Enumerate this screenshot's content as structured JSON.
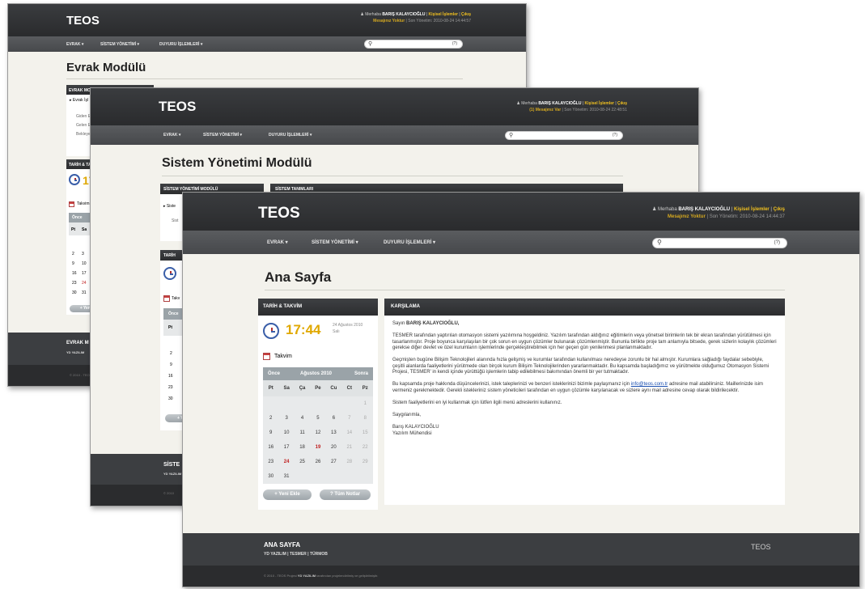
{
  "app": {
    "logo": "TEOS"
  },
  "user": {
    "greeting": "Merhaba",
    "name": "BARIŞ KALAYCIOĞLU",
    "sep": "|",
    "personal_link": "Kişisel İşlemler",
    "logout_link": "Çıkış",
    "messages_none": "Mesajınız Yoktur",
    "messages_back": "(1) Mesajınız Var",
    "last_login_label": "Son Yönetim:",
    "last_login_back": "2010-08-24 14:44:57",
    "last_login_mid": "2010-08-24 22:48:51",
    "last_login_front": "2010-08-24 14:44:37"
  },
  "nav": {
    "items": [
      "EVRAK ▾",
      "SİSTEM YÖNETİMİ ▾",
      "DUYURU İŞLEMLERİ ▾"
    ],
    "search_help": "(?)",
    "search_icon": "magnifier-icon"
  },
  "back": {
    "title": "Evrak Modülü",
    "panel1": "EVRAK MODÜLÜ",
    "list_item": "▸ Evrak İşl",
    "sub_items": [
      "Giden E",
      "Gelen E",
      "Bekleye"
    ],
    "date_panel": "TARİH & TA",
    "time_partial": "17",
    "cal_label": "Takvim",
    "cal_prev": "Önce",
    "weekdays_partial": [
      "Pt",
      "Sa"
    ],
    "days_partial": [
      [
        "2",
        "3"
      ],
      [
        "9",
        "10"
      ],
      [
        "16",
        "17"
      ],
      [
        "23",
        "24"
      ],
      [
        "30",
        "31"
      ]
    ],
    "btn_partial": "+ Yeni",
    "footer_title": "EVRAK M",
    "footer_sub": "YD YAZILIM",
    "copyright": "© 2010 - TEOS"
  },
  "mid": {
    "title": "Sistem Yönetimi Modülü",
    "panel1": "SİSTEM YÖNETİMİ MODÜLÜ",
    "panel2": "SİSTEM TANIMLARI",
    "list_item": "▸ Siste",
    "sub_item": "Sist",
    "date_panel": "TARİH",
    "cal_label": "Takv",
    "cal_prev": "Önce",
    "weekday": "Pt",
    "days_partial": [
      "2",
      "9",
      "16",
      "23",
      "30"
    ],
    "btn_partial": "+ Ye",
    "footer_title": "SİSTE",
    "footer_sub": "YD YAZILIM",
    "copyright": "© 2010"
  },
  "front": {
    "title": "Ana Sayfa",
    "date_panel": "TARİH & TAKVİM",
    "time": "17:44",
    "date_line1": "24 Ağustos 2010",
    "date_line2": "Salı",
    "cal_label": "Takvim",
    "cal_prev": "Önce",
    "cal_month": "Ağustos 2010",
    "cal_next": "Sonra",
    "weekdays": [
      "Pt",
      "Sa",
      "Ça",
      "Pe",
      "Cu",
      "Ct",
      "Pz"
    ],
    "weeks": [
      [
        "",
        "",
        "",
        "",
        "",
        "",
        "1"
      ],
      [
        "2",
        "3",
        "4",
        "5",
        "6",
        "7",
        "8"
      ],
      [
        "9",
        "10",
        "11",
        "12",
        "13",
        "14",
        "15"
      ],
      [
        "16",
        "17",
        "18",
        "19",
        "20",
        "21",
        "22"
      ],
      [
        "23",
        "24",
        "25",
        "26",
        "27",
        "28",
        "29"
      ],
      [
        "30",
        "31",
        "",
        "",
        "",
        "",
        ""
      ]
    ],
    "today": "19",
    "highlight": "24",
    "btn_new": "+ Yeni Ekle",
    "btn_all": "? Tüm Notlar",
    "welcome_panel": "KARŞILAMA",
    "salutation": "Sayın",
    "salutation_name": "BARIŞ KALAYCIOĞLU,",
    "para1": "TESMER tarafından yaptırılan otomasyon sistemi yazılımına hoşgeldiniz. Yazılım tarafından aldığınız eğitimlerin veya yönetsel birimlerin tek bir ekran tarafından yürütülmesi için tasarlanmıştır. Proje boyunca karşılaşılan bir çok sorun en uygun çözümler bulunarak çözümlenmiştir. Bununla birlikte proje tam anlamıyla bitsede, gerek sizlerin kolaylık çözümleri gerekse diğer devlet ve özel kurumların işlemlerinde gerçekleştirebilmek için her geçen gün yenilenmesi planlanmaktadır.",
    "para2": "Geçmişten bugüne Bilişim Teknolojileri alanında hızla gelişmiş ve kurumlar tarafından kullanılması neredeyse zorunlu bir hal almıştır. Kurumlara sağladığı faydalar sebebiyle, çeşitli alanlarda faaliyetlerini yürütmede olan birçok kurum Bilişim Teknolojilerinden yararlanmaktadır. Bu kapsamda başladığımız ve yürütmekte olduğumuz Otomasyon Sistemi Projesi, TESMER' in kendi içinde yürüttüğü işlemlerin tabip edilebilmesi bakımından önemli bir yer tutmaktadır.",
    "para3a": "Bu kapsamda proje hakkında düşüncelerinizi, istek taleplerinizi ve benzeri isteklerinizi bizimle paylaşmanız için",
    "email": "info@teos.com.tr",
    "para3b": "adresine mail atabilirsiniz. Maillerinizde isim vermeniz gerekmektedir. Gerekli istekleriniz sistem yöneticileri tarafından en uygun çözümle karşılanacak ve sizlere aynı mail adresine cevap olarak bildirilecektir.",
    "para4": "Sistem faaliyetlerini en iyi kullanmak için lütfen ilgili menü adreslerini kullanınız.",
    "closing": "Saygılarımla,",
    "signer_name": "Barış KALAYCIOĞLU",
    "signer_title": "Yazılım Mühendisi",
    "footer_title": "ANA SAYFA",
    "footer_links": "YD YAZILIM | TESMER | TÜRMOB",
    "footer_logo": "TEOS",
    "copyright_pre": "© 2010 - TEOS Projesi",
    "copyright_brand": "YD YAZILIM",
    "copyright_post": "tarafından projelendirilmiş ve geliştirilmiştir."
  },
  "colors": {
    "accent": "#f0c020",
    "header": "#2e2f31",
    "nav": "#4e5053",
    "page_bg": "#f3f2ec",
    "calendar_head": "#9aa3a8",
    "today": "#c02020"
  }
}
